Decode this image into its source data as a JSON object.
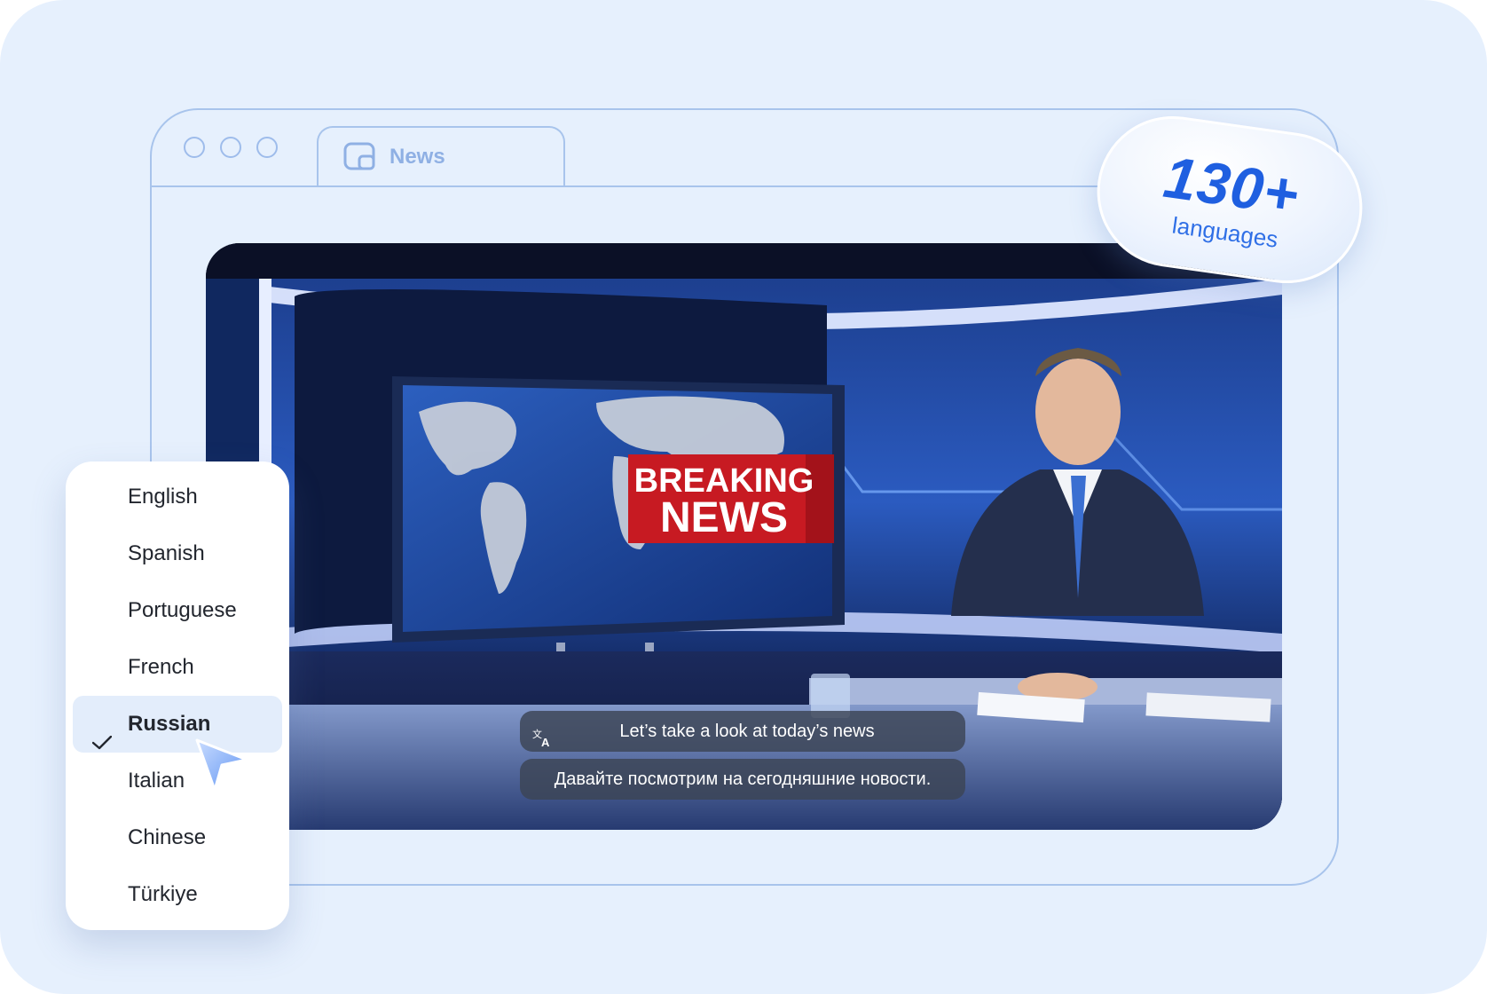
{
  "browser": {
    "tab_label": "News",
    "tab_icon": "picture-in-picture-icon"
  },
  "badge": {
    "count": "130+",
    "label": "languages"
  },
  "video": {
    "banner_line1": "BREAKING",
    "banner_line2": "NEWS"
  },
  "subtitles": {
    "original": "Let’s take a look at today’s news",
    "translated": "Давайте посмотрим на сегодняшние новости.",
    "icon": "translate-icon"
  },
  "language_menu": {
    "selected": "Russian",
    "items": [
      {
        "label": "English"
      },
      {
        "label": "Spanish"
      },
      {
        "label": "Portuguese"
      },
      {
        "label": "French"
      },
      {
        "label": "Russian"
      },
      {
        "label": "Italian"
      },
      {
        "label": "Chinese"
      },
      {
        "label": "Türkiye"
      }
    ]
  },
  "colors": {
    "background": "#e6f0fd",
    "frame": "#a8c4ec",
    "accent": "#1f5fe0",
    "selected_row": "#e3edfb"
  }
}
